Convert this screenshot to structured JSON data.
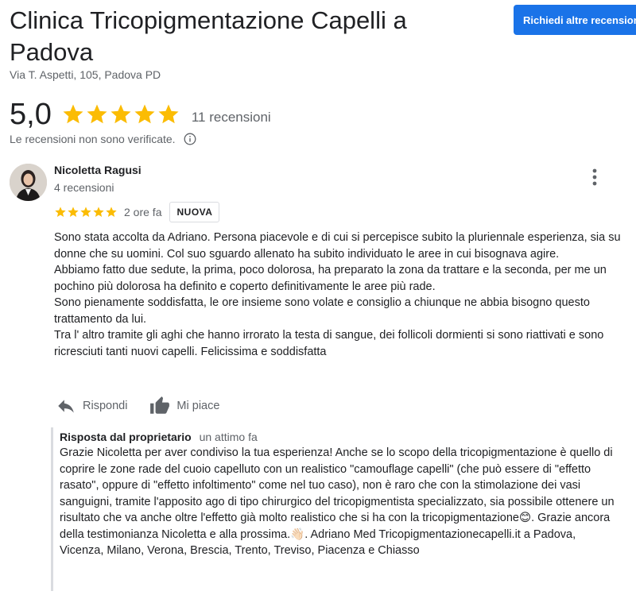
{
  "business": {
    "title": "Clinica Tricopigmentazione Capelli a Padova",
    "address": "Via T. Aspetti, 105, Padova PD",
    "request_button": "Richiedi altre recensioni"
  },
  "summary": {
    "rating": "5,0",
    "stars": 5,
    "review_count": "11 recensioni",
    "unverified_note": "Le recensioni non sono verificate."
  },
  "review": {
    "author": "Nicoletta Ragusi",
    "author_meta": "4 recensioni",
    "stars": 5,
    "time": "2 ore fa",
    "badge": "NUOVA",
    "text": "Sono stata accolta da Adriano. Persona piacevole e di cui si percepisce subito la pluriennale esperienza, sia su donne che su uomini. Col suo sguardo allenato ha subito individuato le aree in cui bisognava agire.\nAbbiamo fatto due sedute, la prima, poco dolorosa, ha preparato la zona da trattare e la seconda, per me un pochino più dolorosa ha definito e coperto definitivamente le aree più rade.\nSono pienamente soddisfatta, le ore insieme sono volate e consiglio a chiunque ne abbia bisogno questo trattamento da lui.\nTra l' altro tramite gli aghi che hanno irrorato la testa di sangue, dei follicoli dormienti si sono riattivati e sono ricresciuti tanti nuovi capelli. Felicissima e soddisfatta",
    "reply_label": "Rispondi",
    "like_label": "Mi piace"
  },
  "owner_reply": {
    "label": "Risposta dal proprietario",
    "time": "un attimo fa",
    "text": "Grazie Nicoletta per aver condiviso la tua esperienza! Anche se lo scopo della tricopigmentazione è quello di coprire le zone rade del cuoio capelluto con un realistico \"camouflage capelli\" (che può essere di \"effetto rasato\", oppure di \"effetto infoltimento\" come nel tuo caso), non è raro che con la stimolazione dei vasi sanguigni, tramite l'apposito ago di tipo chirurgico del tricopigmentista specializzato, sia possibile ottenere un risultato che va anche oltre l'effetto già molto realistico che si ha con la tricopigmentazione😊. Grazie ancora della testimonianza Nicoletta e alla prossima.👋🏻. Adriano Med Tricopigmentazionecapelli.it a Padova, Vicenza, Milano, Verona, Brescia, Trento, Treviso, Piacenza e Chiasso"
  },
  "colors": {
    "star": "#fbbc04",
    "accent": "#1a73e8",
    "secondary_text": "#5f6368"
  }
}
